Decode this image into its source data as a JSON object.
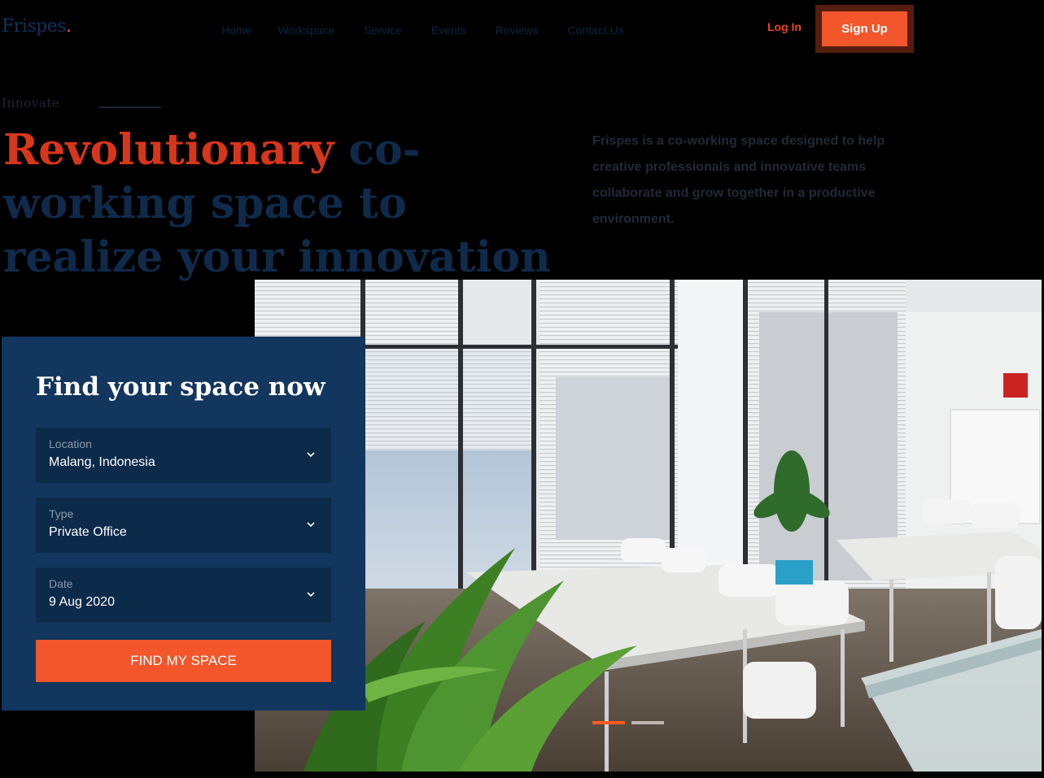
{
  "brand": {
    "logo": "Frispes",
    "logo_dot": "."
  },
  "nav": {
    "items": [
      "Home",
      "Workspace",
      "Service",
      "Events",
      "Reviews",
      "Contact Us"
    ]
  },
  "auth": {
    "login": "Log In",
    "signup": "Sign Up"
  },
  "hero": {
    "tagline": "Innovate",
    "headline_accent": "Revolutionary",
    "headline_rest": " co-working space to realize your innovation",
    "description": "Frispes is a co-working space designed to help creative professionals and innovative teams collaborate and grow together in a productive environment."
  },
  "search": {
    "title": "Find your space now",
    "fields": [
      {
        "label": "Location",
        "value": "Malang, Indonesia"
      },
      {
        "label": "Type",
        "value": "Private Office"
      },
      {
        "label": "Date",
        "value": "9 Aug 2020"
      }
    ],
    "button": "FIND MY SPACE"
  },
  "slider": {
    "count": 3,
    "active": 1
  },
  "colors": {
    "primary": "#12365e",
    "accent": "#f2562a",
    "heading": "#0f2a4a"
  },
  "icons": {
    "chevron": "chevron-down-icon"
  }
}
